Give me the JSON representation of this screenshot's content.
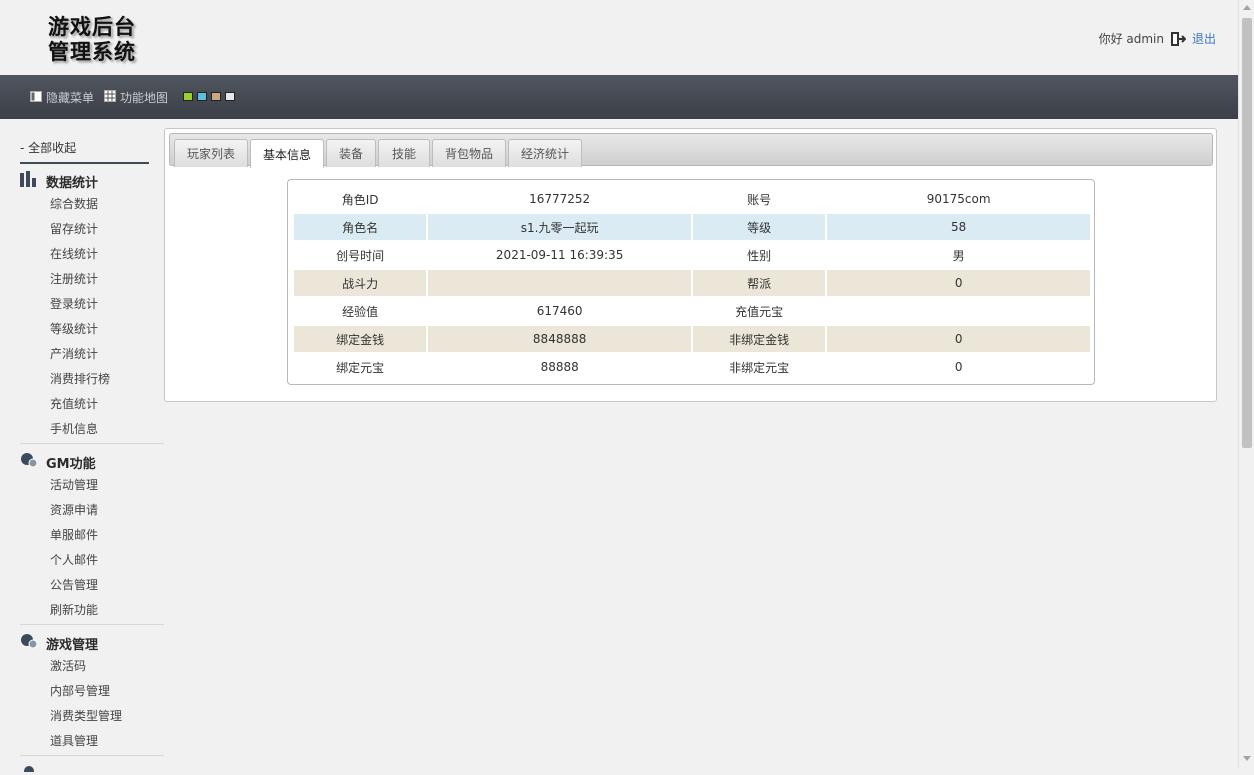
{
  "header": {
    "logo_line1": "游戏后台",
    "logo_line2": "管理系统",
    "greeting": "你好 admin",
    "logout_label": "退出"
  },
  "toolbar": {
    "hide_menu_label": "隐藏菜单",
    "function_map_label": "功能地图",
    "theme_colors": [
      "#9acd32",
      "#5bc0de",
      "#c8a97e",
      "#e6e6e6"
    ]
  },
  "sidebar": {
    "collapse_all_label": "- 全部收起",
    "groups": [
      {
        "title": "数据统计",
        "icon": "bar-chart-icon",
        "items": [
          "综合数据",
          "留存统计",
          "在线统计",
          "注册统计",
          "登录统计",
          "等级统计",
          "产消统计",
          "消费排行榜",
          "充值统计",
          "手机信息"
        ]
      },
      {
        "title": "GM功能",
        "icon": "gear-bubble-icon",
        "items": [
          "活动管理",
          "资源申请",
          "单服邮件",
          "个人邮件",
          "公告管理",
          "刷新功能"
        ]
      },
      {
        "title": "游戏管理",
        "icon": "gear-bubble-icon",
        "items": [
          "激活码",
          "内部号管理",
          "消费类型管理",
          "道具管理"
        ]
      }
    ]
  },
  "tabs": {
    "items": [
      "玩家列表",
      "基本信息",
      "装备",
      "技能",
      "背包物品",
      "经济统计"
    ],
    "active": "基本信息"
  },
  "player_info": {
    "rows": [
      [
        "角色ID",
        "16777252",
        "账号",
        "90175com"
      ],
      [
        "角色名",
        "s1.九零一起玩",
        "等级",
        "58"
      ],
      [
        "创号时间",
        "2021-09-11 16:39:35",
        "性别",
        "男"
      ],
      [
        "战斗力",
        "",
        "帮派",
        "0"
      ],
      [
        "经验值",
        "617460",
        "充值元宝",
        ""
      ],
      [
        "绑定金钱",
        "8848888",
        "非绑定金钱",
        "0"
      ],
      [
        "绑定元宝",
        "88888",
        "非绑定元宝",
        "0"
      ]
    ]
  }
}
